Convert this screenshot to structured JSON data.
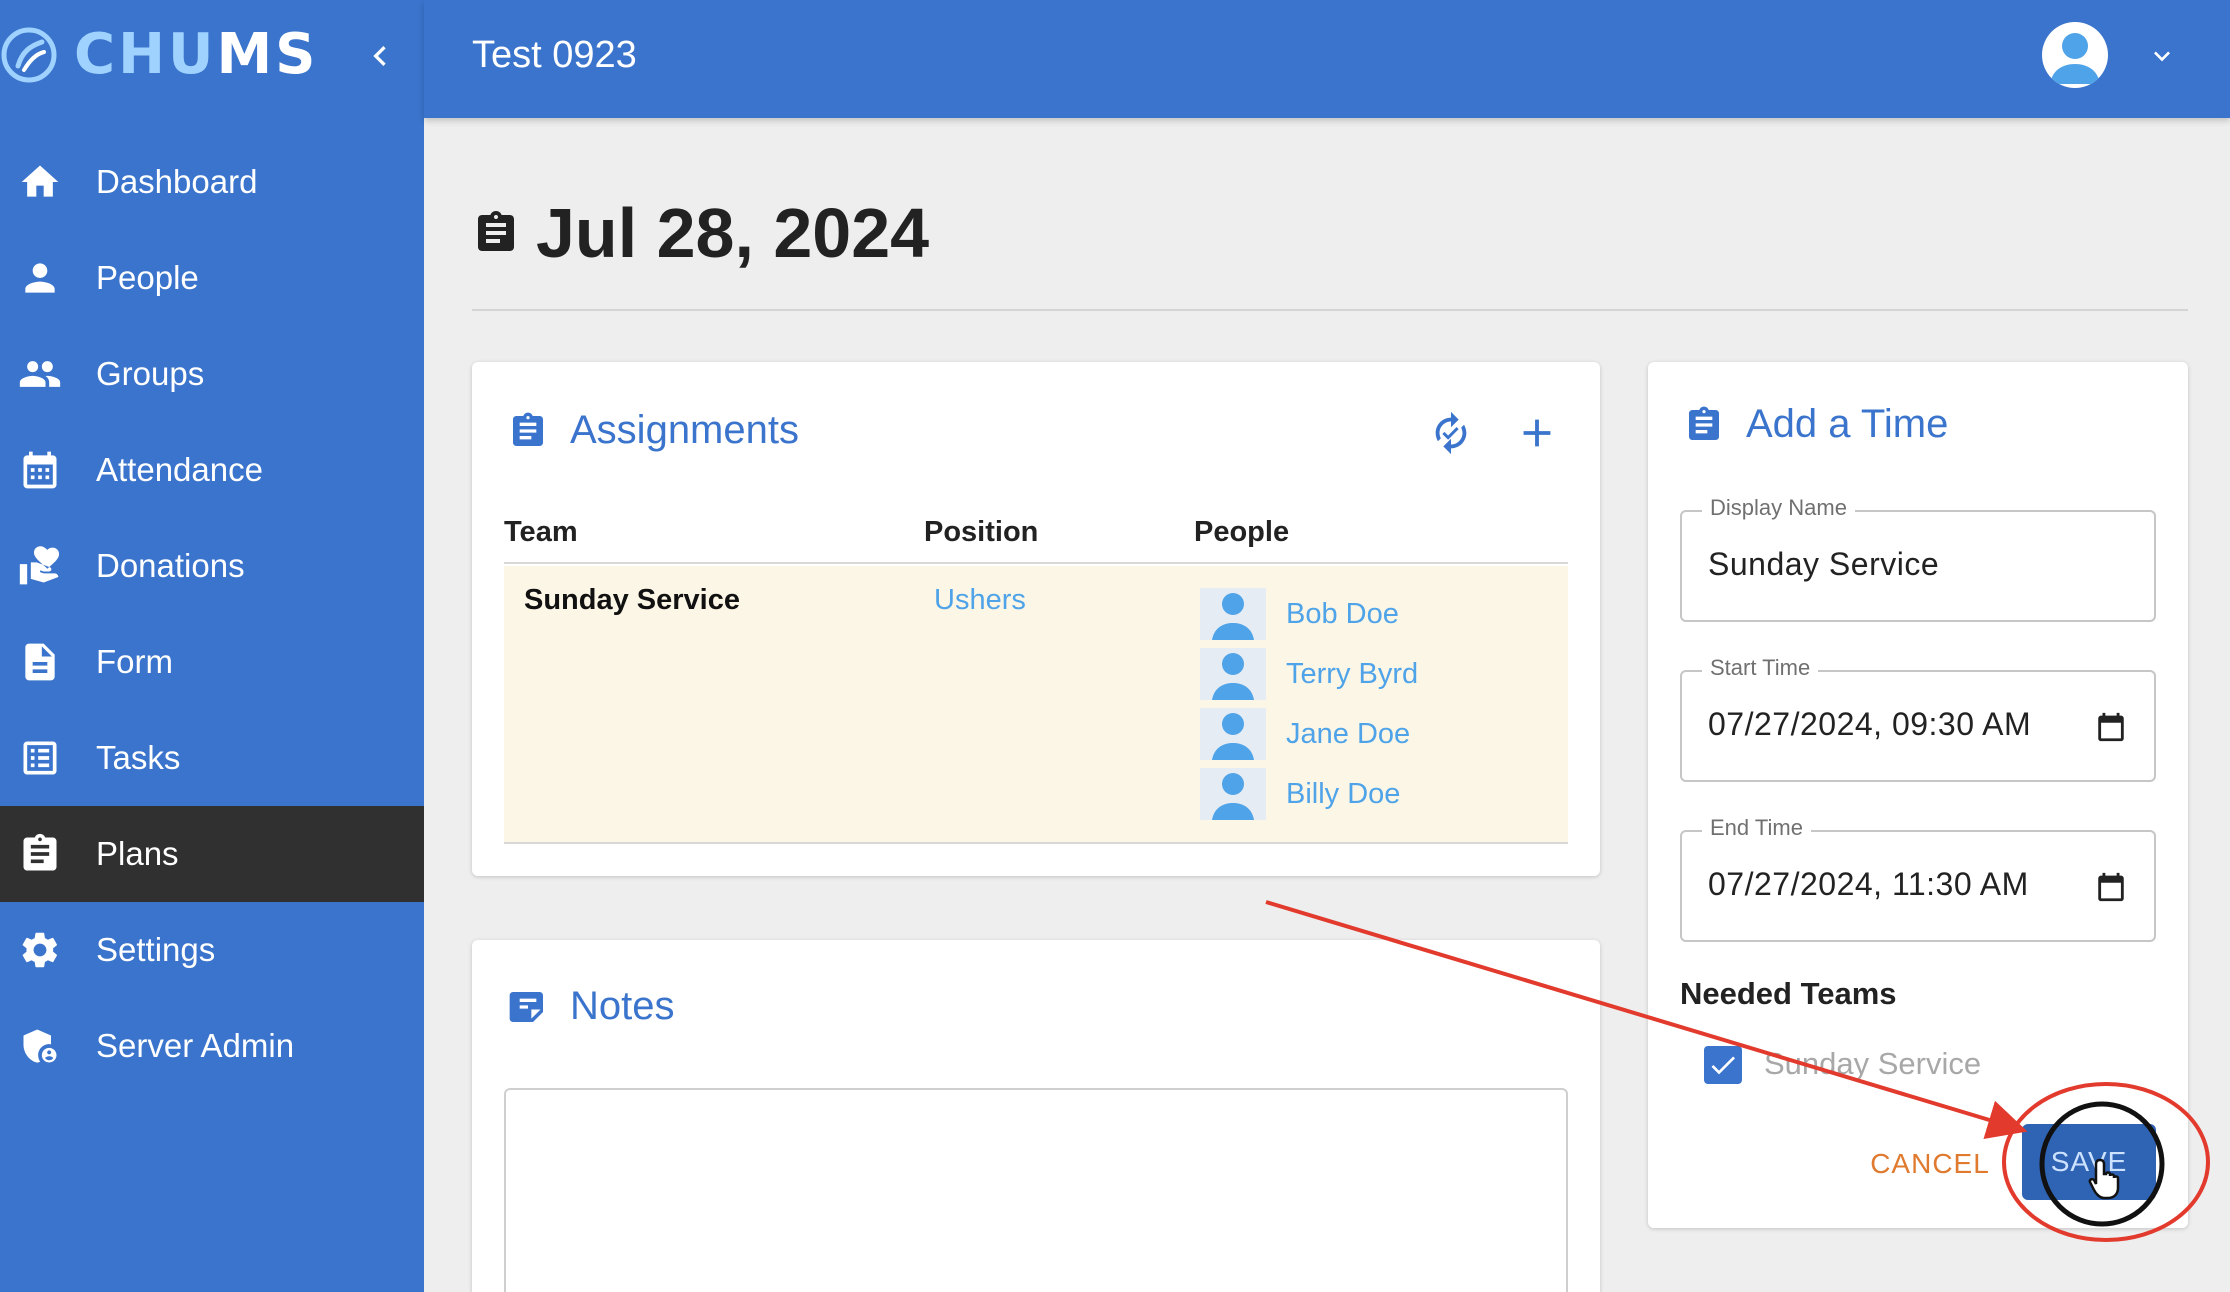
{
  "brand": {
    "name_part1": "CHU",
    "name_part2": "MS"
  },
  "header": {
    "church_name": "Test 0923"
  },
  "sidebar": {
    "items": [
      {
        "label": "Dashboard",
        "icon": "home-icon"
      },
      {
        "label": "People",
        "icon": "person-icon"
      },
      {
        "label": "Groups",
        "icon": "groups-icon"
      },
      {
        "label": "Attendance",
        "icon": "calendar-icon"
      },
      {
        "label": "Donations",
        "icon": "donations-icon"
      },
      {
        "label": "Form",
        "icon": "form-icon"
      },
      {
        "label": "Tasks",
        "icon": "tasks-icon"
      },
      {
        "label": "Plans",
        "icon": "clipboard-icon",
        "active": true
      },
      {
        "label": "Settings",
        "icon": "gear-icon"
      },
      {
        "label": "Server Admin",
        "icon": "admin-shield-icon"
      }
    ]
  },
  "page": {
    "title": "Jul 28, 2024"
  },
  "assignments": {
    "title": "Assignments",
    "columns": [
      "Team",
      "Position",
      "People"
    ],
    "rows": [
      {
        "team": "Sunday Service",
        "position": "Ushers",
        "people": [
          "Bob Doe",
          "Terry Byrd",
          "Jane Doe",
          "Billy Doe"
        ]
      }
    ]
  },
  "notes": {
    "title": "Notes"
  },
  "add_time": {
    "title": "Add a Time",
    "display_name": {
      "label": "Display Name",
      "value": "Sunday Service"
    },
    "start_time": {
      "label": "Start Time",
      "value": "07/27/2024, 09:30 AM"
    },
    "end_time": {
      "label": "End Time",
      "value": "07/27/2024, 11:30 AM"
    },
    "needed_teams_title": "Needed Teams",
    "team_option": {
      "label": "Sunday Service",
      "checked": true
    },
    "cancel_label": "CANCEL",
    "save_label": "SAVE"
  },
  "colors": {
    "primary": "#3a74cc",
    "active_nav": "#303030",
    "link": "#4fa3e8",
    "cancel": "#e07a2e",
    "annotation": "#e23b2e",
    "row_highlight": "#fcf6e6"
  }
}
